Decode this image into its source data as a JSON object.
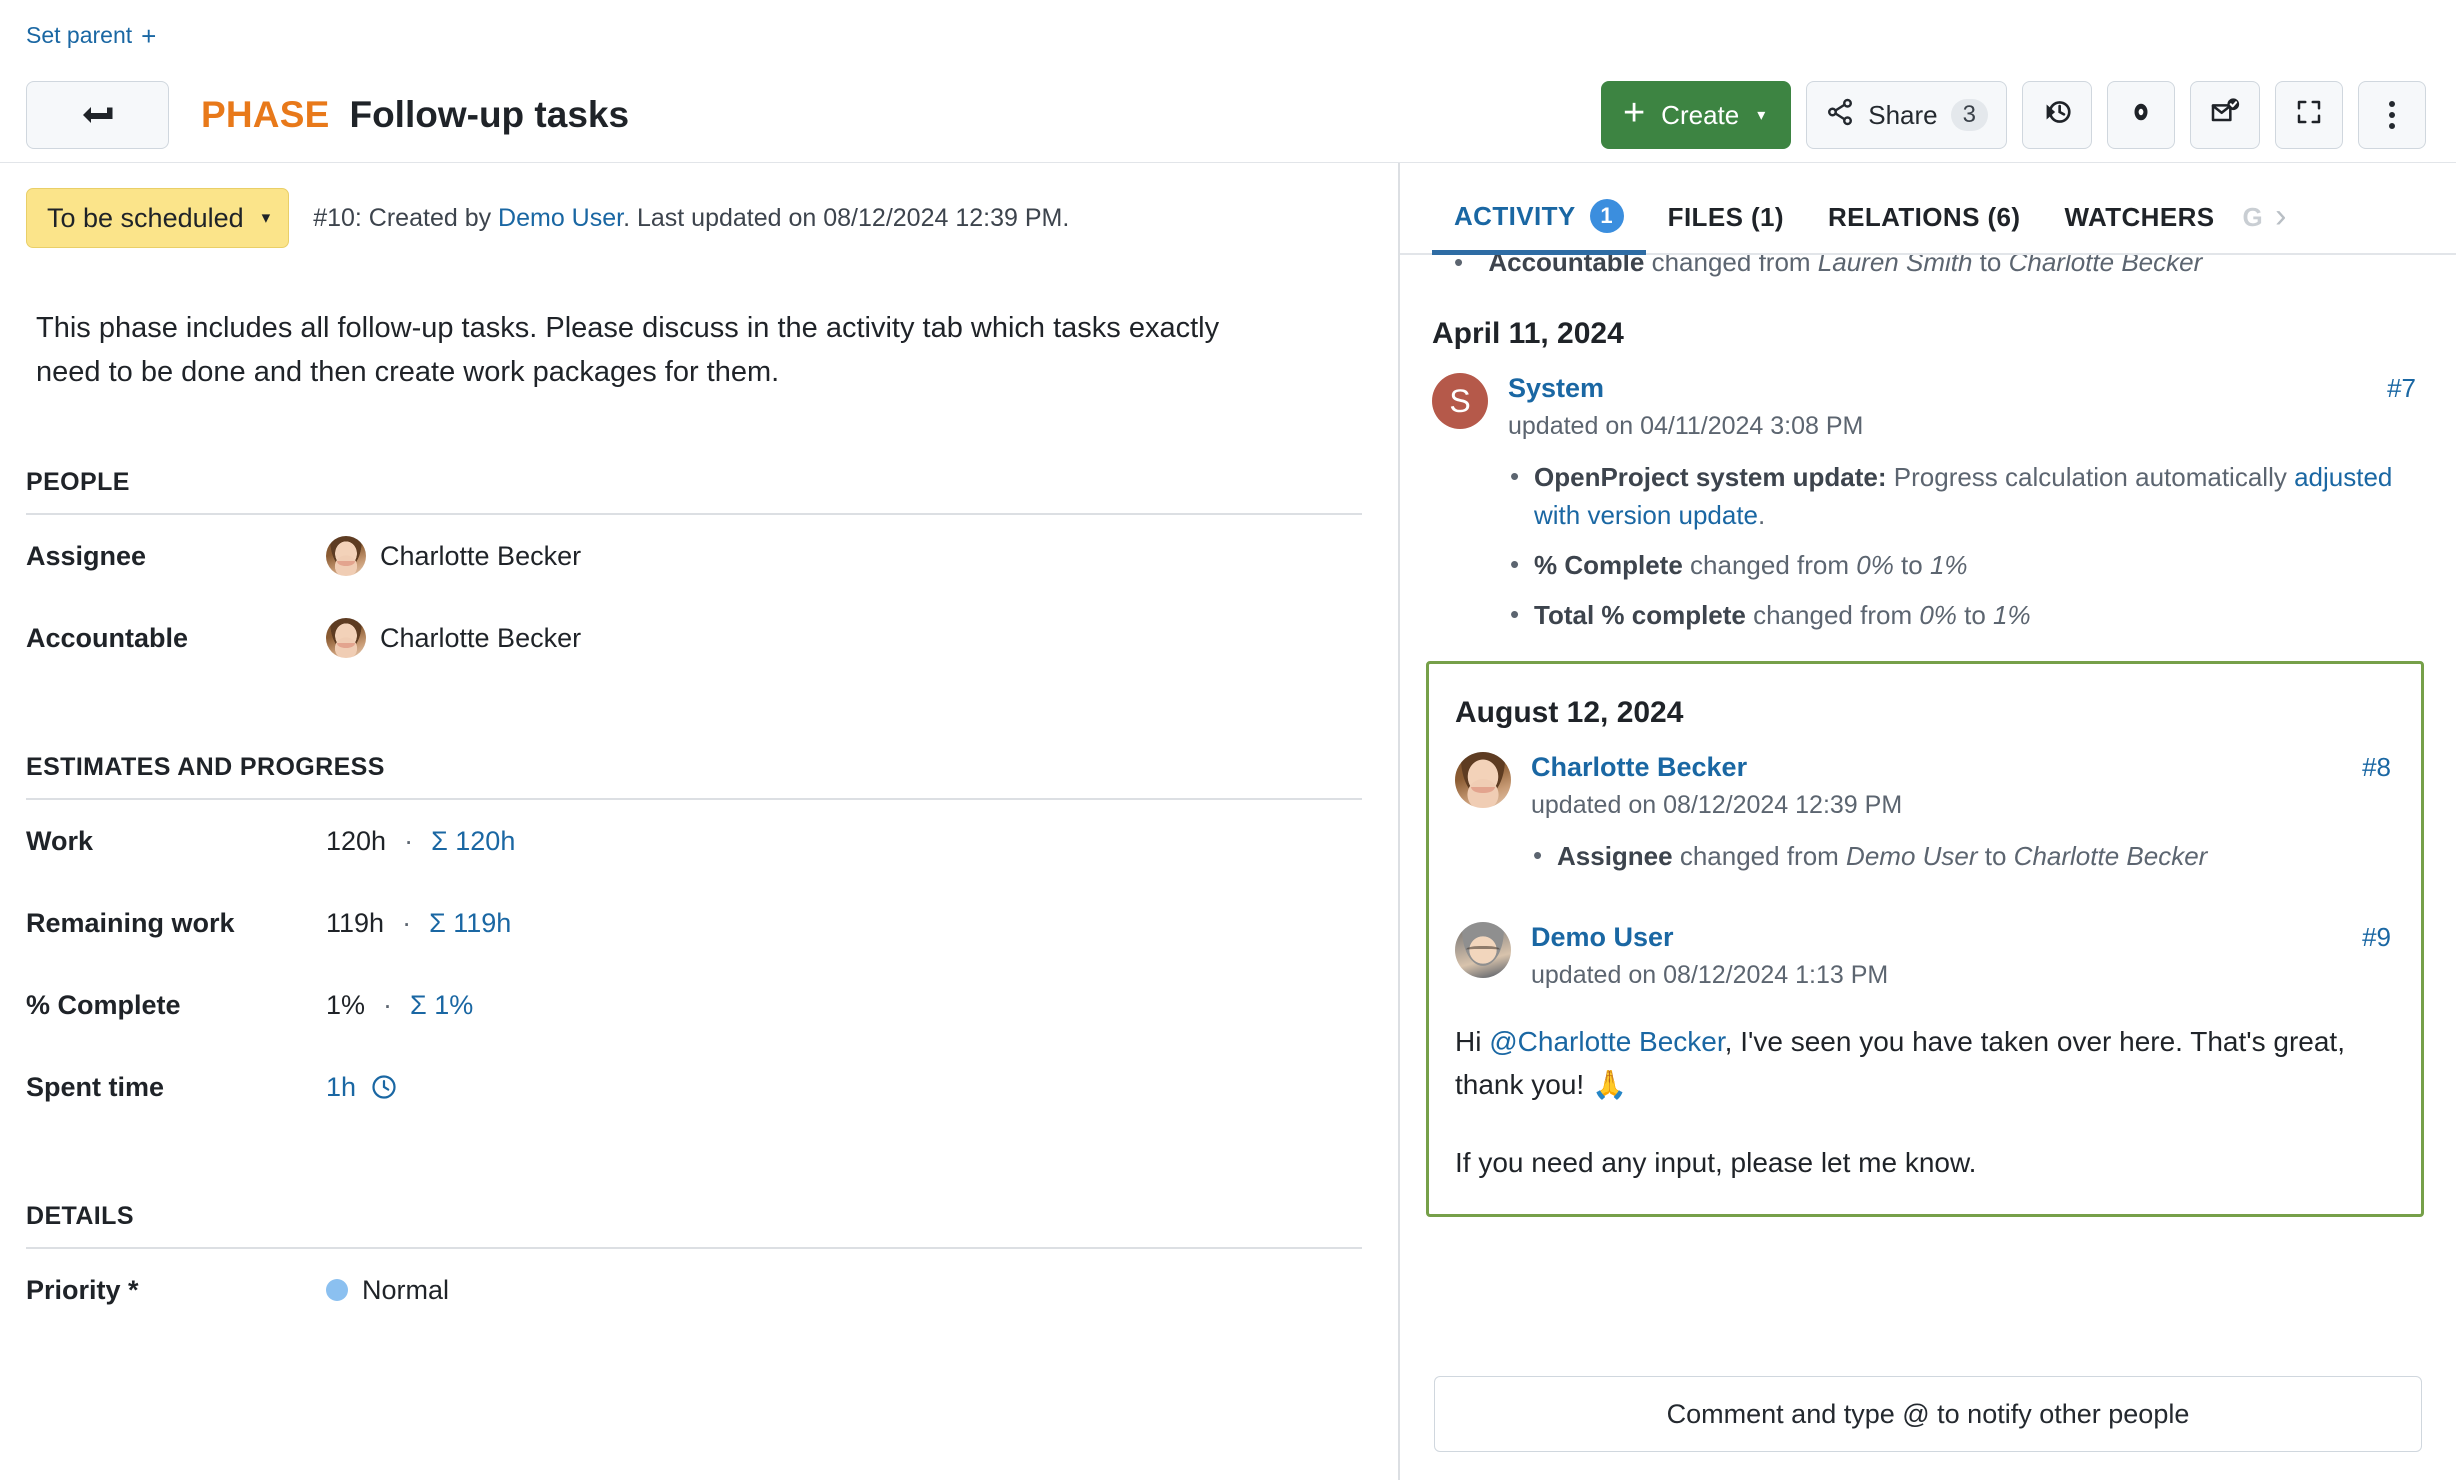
{
  "header": {
    "set_parent_label": "Set parent",
    "set_parent_plus": "+",
    "back_icon": "back-arrow-icon",
    "work_package_type": "PHASE",
    "subject": "Follow-up tasks",
    "toolbar": {
      "create_label": "Create",
      "create_plus": "+",
      "create_caret": "▾",
      "share_label": "Share",
      "share_count": "3",
      "time_icon": "time-tracking-icon",
      "watch_icon": "watch-eye-icon",
      "notification_icon": "mark-notification-read-icon",
      "fullscreen_icon": "fullscreen-icon",
      "more_icon": "more-vertical-icon"
    }
  },
  "left": {
    "status": {
      "label": "To be scheduled",
      "caret": "▾",
      "bg_color": "#fbe48a"
    },
    "meta": {
      "prefix": "#10: Created by ",
      "author": "Demo User",
      "suffix": ". Last updated on 08/12/2024 12:39 PM."
    },
    "description": "This phase includes all follow-up tasks. Please discuss in the activity tab which tasks exactly need to be done and then create work packages for them.",
    "sections": [
      {
        "title": "PEOPLE",
        "fields": [
          {
            "label": "Assignee",
            "value": "Charlotte Becker",
            "avatar": "charlotte"
          },
          {
            "label": "Accountable",
            "value": "Charlotte Becker",
            "avatar": "charlotte"
          }
        ]
      },
      {
        "title": "ESTIMATES AND PROGRESS",
        "fields": [
          {
            "label": "Work",
            "value": "120h",
            "separator": "·",
            "sum": "Σ 120h"
          },
          {
            "label": "Remaining work",
            "value": "119h",
            "separator": "·",
            "sum": "Σ 119h"
          },
          {
            "label": "% Complete",
            "value": "1%",
            "separator": "·",
            "sum": "Σ 1%"
          },
          {
            "label": "Spent time",
            "link": "1h",
            "icon": "clock-icon"
          }
        ]
      },
      {
        "title": "DETAILS",
        "fields": [
          {
            "label": "Priority *",
            "value": "Normal",
            "dot_color": "#8bc0f0"
          }
        ]
      }
    ]
  },
  "right": {
    "tabs": [
      {
        "label": "ACTIVITY",
        "badge": "1",
        "active": true
      },
      {
        "label": "FILES (1)",
        "active": false
      },
      {
        "label": "RELATIONS (6)",
        "active": false
      },
      {
        "label": "WATCHERS",
        "active": false
      },
      {
        "label": "G",
        "faded": true
      }
    ],
    "tab_scroll_next_icon": "chevron-right-icon",
    "clipped_entry": {
      "field": "Accountable",
      "text_before": " changed from ",
      "old_value": "Lauren Smith",
      "text_mid": " to ",
      "new_value": "Charlotte Becker"
    },
    "groups": [
      {
        "date": "April 11, 2024",
        "highlighted": false,
        "entries": [
          {
            "author": "System",
            "avatar": "system",
            "avatar_initial": "S",
            "time": "updated on 04/11/2024 3:08 PM",
            "reference": "#7",
            "changes": [
              {
                "bold": "OpenProject system update:",
                "text": " Progress calculation automatically ",
                "link": "adjusted with version update",
                "tail": "."
              },
              {
                "bold": "% Complete",
                "text": " changed from ",
                "italic_old": "0%",
                "text_mid": " to ",
                "italic_new": "1%"
              },
              {
                "bold": "Total % complete",
                "text": " changed from ",
                "italic_old": "0%",
                "text_mid": " to ",
                "italic_new": "1%"
              }
            ]
          }
        ]
      },
      {
        "date": "August 12, 2024",
        "highlighted": true,
        "highlight_color": "#76a049",
        "entries": [
          {
            "author": "Charlotte Becker",
            "avatar": "charlotte",
            "time": "updated on 08/12/2024 12:39 PM",
            "reference": "#8",
            "changes": [
              {
                "bold": "Assignee",
                "text": " changed from ",
                "italic_old": "Demo User",
                "text_mid": " to ",
                "italic_new": "Charlotte Becker"
              }
            ]
          },
          {
            "author": "Demo User",
            "avatar": "demo",
            "time": "updated on 08/12/2024 1:13 PM",
            "reference": "#9",
            "comment": {
              "line1_before": "Hi ",
              "mention": "@Charlotte Becker",
              "line1_after": ", I've seen you have taken over here. That's great, thank you! 🙏",
              "line2": "If you need any input, please let me know."
            }
          }
        ]
      }
    ],
    "comment_box_placeholder": "Comment and type @ to notify other people"
  }
}
